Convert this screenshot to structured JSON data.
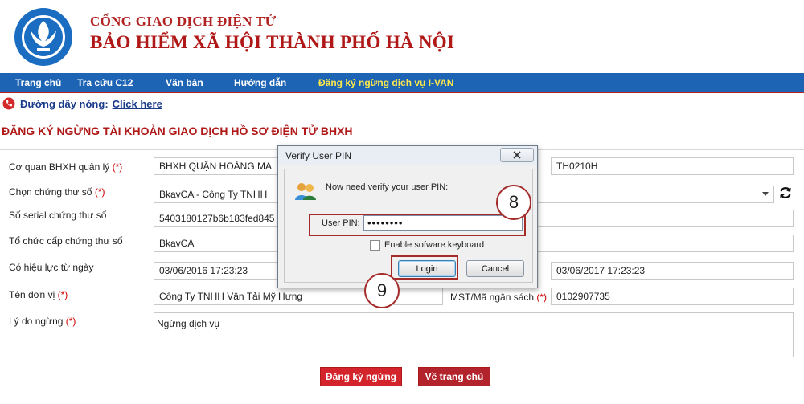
{
  "header": {
    "portal_title": "CỔNG GIAO DỊCH ĐIỆN TỬ",
    "org_title": "BẢO HIỂM XÃ HỘI THÀNH PHỐ HÀ NỘI",
    "logo_text": "BẢO HIỂM XÃ HỘI THÀNH PHỐ HÀ NỘI"
  },
  "nav": {
    "items": [
      "Trang chủ",
      "Tra cứu C12",
      "Văn bản",
      "Hướng dẫn",
      "Đăng ký ngừng dịch vụ I-VAN"
    ],
    "active_index": 4
  },
  "hotline": {
    "label": "Đường dây nóng:",
    "link": "Click here"
  },
  "page_heading": "ĐĂNG KÝ NGỪNG TÀI KHOẢN GIAO DỊCH HỒ SƠ ĐIỆN TỬ BHXH",
  "form": {
    "agency_label": "Cơ quan BHXH quản lý",
    "agency_value": "BHXH QUẬN HOÀNG MA",
    "agency_code": "TH0210H",
    "cert_label": "Chọn chứng thư số",
    "cert_value": "BkavCA - Công Ty TNHH",
    "serial_label": "Số serial chứng thư số",
    "serial_value": "5403180127b6b183fed845",
    "issuer_label": "Tổ chức cấp chứng thư số",
    "issuer_value": "BkavCA",
    "validity_label": "Có hiệu lực từ ngày",
    "valid_from": "03/06/2016 17:23:23",
    "valid_to": "03/06/2017 17:23:23",
    "unit_label": "Tên đơn vị",
    "unit_value": "Công Ty TNHH Vận Tải Mỹ Hưng",
    "tax_label": "MST/Mã ngân sách",
    "tax_value": "0102907735",
    "reason_label": "Lý do ngừng",
    "reason_value": "Ngừng dịch vụ",
    "required_mark": "(*)"
  },
  "buttons": {
    "register": "Đăng ký ngừng",
    "home": "Về trang chủ"
  },
  "dialog": {
    "title": "Verify User PIN",
    "message": "Now need verify your user PIN:",
    "pin_label": "User PIN:",
    "pin_value": "••••••••",
    "keyboard_label": "Enable sofware keyboard",
    "login": "Login",
    "cancel": "Cancel"
  },
  "annotations": {
    "step_pin": "8",
    "step_login": "9"
  },
  "colors": {
    "nav_bg": "#1e64b4",
    "brand_red": "#b01818",
    "active_nav": "#ffe94a",
    "link_blue": "#1a3b8a"
  }
}
